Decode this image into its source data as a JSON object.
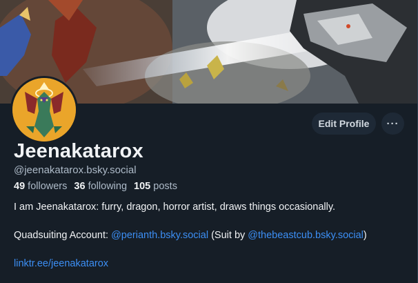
{
  "profile": {
    "display_name": "Jeenakatarox",
    "handle": "@jeenakatarox.bsky.social",
    "stats": {
      "followers_count": "49",
      "followers_label": "followers",
      "following_count": "36",
      "following_label": "following",
      "posts_count": "105",
      "posts_label": "posts"
    },
    "bio": {
      "line1": "I am Jeenakatarox: furry, dragon, horror artist, draws things occasionally.",
      "line2_prefix": "Quadsuiting Account: ",
      "line2_link1": "@perianth.bsky.social",
      "line2_middle": " (Suit by ",
      "line2_link2": "@thebeastcub.bsky.social",
      "line2_suffix": ")",
      "line3_link": "linktr.ee/jeenakatarox"
    }
  },
  "actions": {
    "edit_label": "Edit Profile",
    "more_label": "···"
  },
  "colors": {
    "background": "#161e27",
    "button_bg": "#1e2936",
    "link": "#3c8ff5",
    "muted_text": "#aebbc9"
  },
  "icons": {
    "more": "ellipsis-icon"
  }
}
